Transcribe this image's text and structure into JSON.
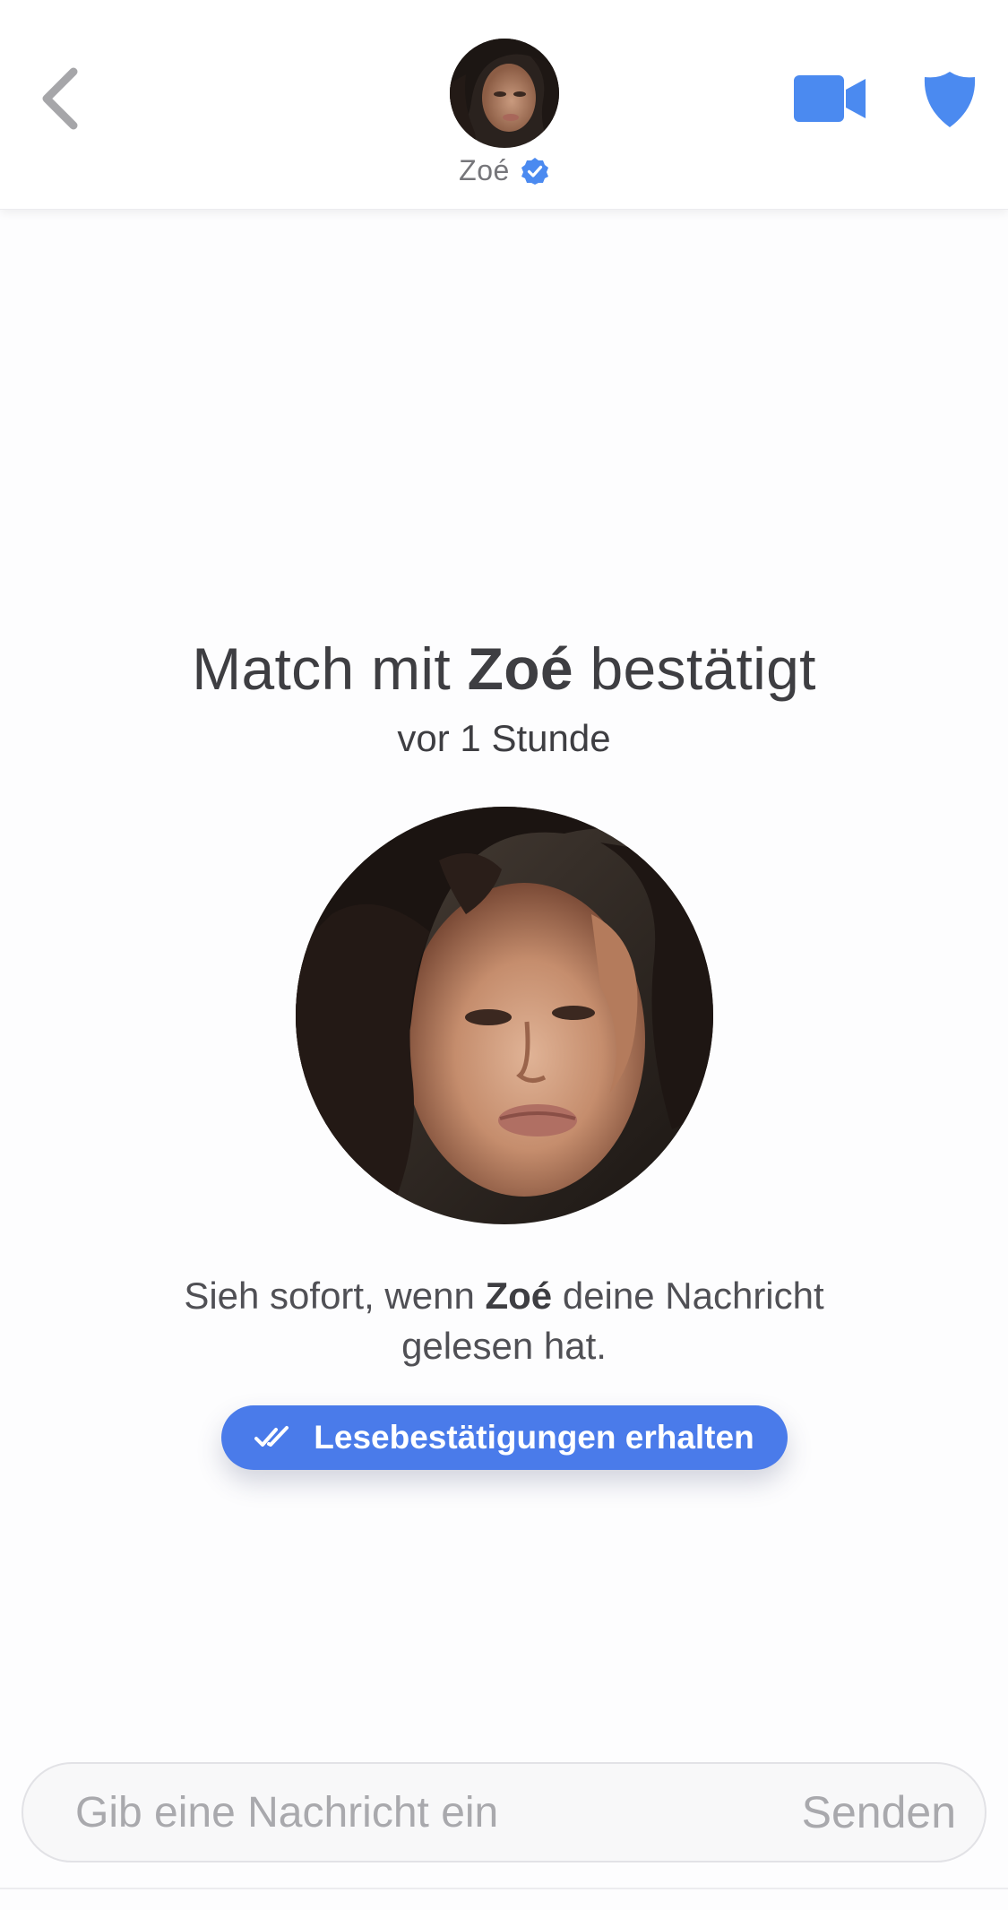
{
  "header": {
    "name": "Zoé",
    "back_icon": "chevron-left-icon",
    "video_icon": "video-camera-icon",
    "safety_icon": "shield-icon",
    "verified_icon": "verified-badge-icon"
  },
  "match": {
    "title_prefix": "Match mit ",
    "title_name": "Zoé",
    "title_suffix": " bestätigt",
    "time": "vor 1 Stunde"
  },
  "read_receipts": {
    "text_prefix": "Sieh sofort, wenn ",
    "text_name": "Zoé",
    "text_suffix": " deine Nachricht gelesen hat.",
    "button_label": "Lesebestätigungen erhalten",
    "button_icon": "double-check-icon"
  },
  "composer": {
    "placeholder": "Gib eine Nachricht ein",
    "send_label": "Senden"
  },
  "colors": {
    "accent": "#4a7bea",
    "icon_blue": "#4b8af0",
    "back_gray": "#a6a6a9"
  }
}
